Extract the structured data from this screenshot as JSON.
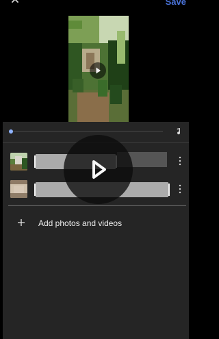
{
  "header": {
    "save_label": "Save",
    "back_icon": "chevron-up-icon"
  },
  "preview": {
    "play_icon": "play-circle-icon"
  },
  "timeline": {
    "progress": 0.02,
    "music_icon": "music-note-icon"
  },
  "clips": [
    {
      "thumbnail": "plant-photo",
      "menu_icon": "more-vert-icon"
    },
    {
      "thumbnail": "stone-video",
      "menu_icon": "more-vert-icon"
    }
  ],
  "footer": {
    "add_label": "Add photos and videos",
    "add_icon": "plus-icon"
  },
  "overlay": {
    "play_icon": "play-icon"
  },
  "colors": {
    "accent": "#4a73d9",
    "panel": "#252525",
    "clip_bar": "#ababab",
    "background": "#000000"
  }
}
